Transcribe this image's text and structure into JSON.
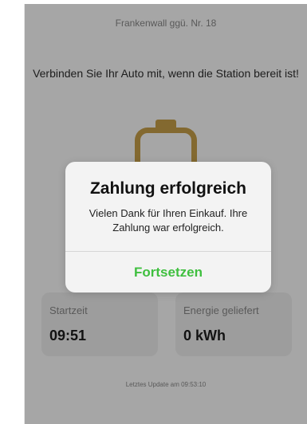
{
  "station": {
    "address": "Frankenwall ggü. Nr. 18",
    "instruction": "Verbinden Sie Ihr Auto mit, wenn die Station bereit ist!"
  },
  "stats": {
    "start_time": {
      "label": "Startzeit",
      "value": "09:51"
    },
    "energy": {
      "label": "Energie geliefert",
      "value": "0 kWh"
    }
  },
  "last_update": "Letztes Update am 09:53:10",
  "alert": {
    "title": "Zahlung erfolgreich",
    "message": "Vielen Dank für Ihren Einkauf. Ihre Zahlung war erfolgreich.",
    "action_label": "Fortsetzen"
  },
  "colors": {
    "accent_green": "#3fbf3f",
    "plug_gold": "#caa24a",
    "overlay": "rgba(0,0,0,0.35)"
  },
  "icons": {
    "plug": "charging-plug-icon"
  }
}
